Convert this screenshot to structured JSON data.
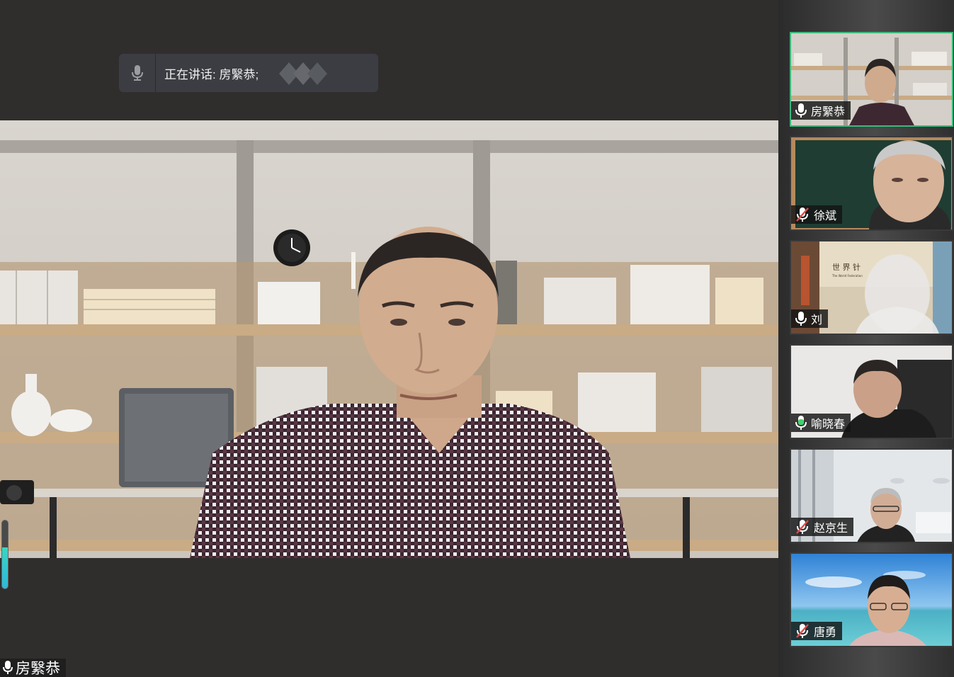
{
  "speaking_banner": {
    "label": "正在讲话: 房繄恭;"
  },
  "main_video": {
    "participant_name": "房繄恭",
    "audio_level": 0.6
  },
  "participants": [
    {
      "name": "房繄恭",
      "mic": "on",
      "active": true
    },
    {
      "name": "徐斌",
      "mic": "muted",
      "active": false
    },
    {
      "name": "刘",
      "mic": "on",
      "active": false
    },
    {
      "name": "喻晓春",
      "mic": "on-speaking",
      "active": false
    },
    {
      "name": "赵京生",
      "mic": "muted",
      "active": false
    },
    {
      "name": "唐勇",
      "mic": "muted",
      "active": false
    }
  ],
  "tile_scene_texts": {
    "sign_line1": "世 界 针",
    "sign_line2": "The World Federation"
  },
  "colors": {
    "active_border": "#3bb87a",
    "speaking_mic": "#3fd36b",
    "muted_slash": "#e04a4a",
    "meter": "#3ad6c3"
  },
  "icons": {
    "mic": "microphone-icon",
    "mic_muted": "microphone-muted-icon"
  }
}
